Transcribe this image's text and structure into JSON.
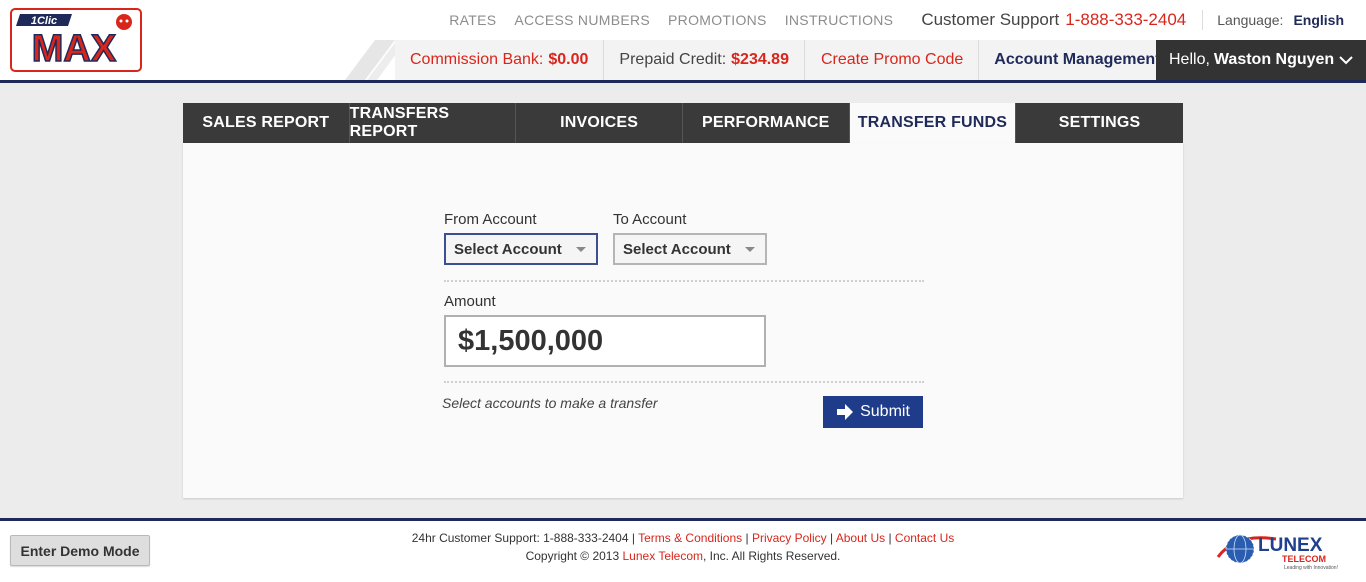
{
  "brand": {
    "logo_top": "1Clic",
    "logo_main": "MAX"
  },
  "topnav": {
    "links": [
      "RATES",
      "ACCESS NUMBERS",
      "PROMOTIONS",
      "INSTRUCTIONS"
    ],
    "support_label": "Customer Support",
    "support_phone": "1-888-333-2404",
    "language_label": "Language:",
    "language_value": "English"
  },
  "subbar": {
    "commission_label": "Commission Bank:",
    "commission_value": "$0.00",
    "prepaid_label": "Prepaid Credit:",
    "prepaid_value": "$234.89",
    "promo_label": "Create Promo Code",
    "account_label": "Account Management",
    "greeting": "Hello,",
    "user_name": "Waston Nguyen"
  },
  "tabs": [
    {
      "label": "SALES REPORT",
      "active": false
    },
    {
      "label": "TRANSFERS REPORT",
      "active": false
    },
    {
      "label": "INVOICES",
      "active": false
    },
    {
      "label": "PERFORMANCE",
      "active": false
    },
    {
      "label": "TRANSFER FUNDS",
      "active": true
    },
    {
      "label": "SETTINGS",
      "active": false
    }
  ],
  "form": {
    "from_label": "From Account",
    "from_value": "Select Account",
    "to_label": "To Account",
    "to_value": "Select Account",
    "amount_label": "Amount",
    "amount_value": "$1,500,000",
    "hint": "Select accounts to make a transfer",
    "submit_label": "Submit"
  },
  "footer": {
    "demo_button": "Enter Demo Mode",
    "support_text": "24hr Customer Support: 1-888-333-2404 |",
    "links": [
      "Terms & Conditions",
      "Privacy Policy",
      "About Us",
      "Contact Us"
    ],
    "copyright_prefix": "Copyright © 2013",
    "copyright_company": "Lunex Telecom",
    "copyright_suffix": ", Inc. All Rights Reserved.",
    "partner_name": "LUNEX",
    "partner_sub": "TELECOM",
    "partner_tagline": "Leading with Innovation!"
  },
  "colors": {
    "brand_red": "#d9261c",
    "navy": "#1f2a5a",
    "submit_blue": "#1e3c8a",
    "tab_dark": "#3a3a3a"
  }
}
